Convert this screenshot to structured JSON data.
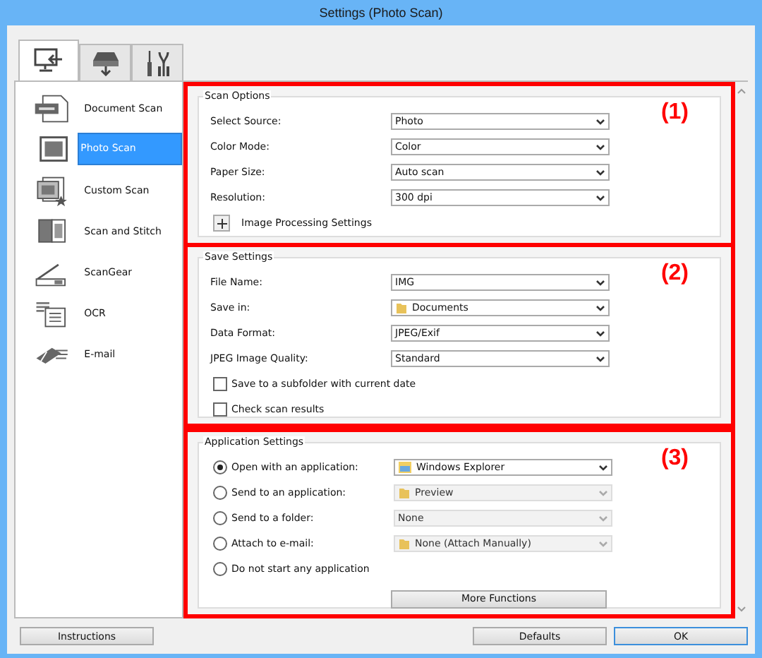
{
  "window": {
    "title": "Settings (Photo Scan)"
  },
  "tabs": [
    {
      "kind": "computer",
      "selected": true
    },
    {
      "kind": "scanner",
      "selected": false
    },
    {
      "kind": "tools",
      "selected": false
    }
  ],
  "sidebar": {
    "items": [
      {
        "label": "Document Scan",
        "kind": "pdf",
        "selected": false
      },
      {
        "label": "Photo Scan",
        "kind": "photo",
        "selected": true
      },
      {
        "label": "Custom Scan",
        "kind": "custom",
        "selected": false
      },
      {
        "label": "Scan and Stitch",
        "kind": "stitch",
        "selected": false
      },
      {
        "label": "ScanGear",
        "kind": "scangear",
        "selected": false
      },
      {
        "label": "OCR",
        "kind": "ocr",
        "selected": false
      },
      {
        "label": "E-mail",
        "kind": "email",
        "selected": false
      }
    ]
  },
  "sections": [
    {
      "marker": "(1)",
      "title": "Scan Options",
      "rows": [
        {
          "kind": "select",
          "label": "Select Source:",
          "dropdown": {
            "kind": "plain",
            "value": "Photo",
            "disabled": false
          }
        },
        {
          "kind": "select",
          "label": "Color Mode:",
          "dropdown": {
            "kind": "plain",
            "value": "Color",
            "disabled": false
          }
        },
        {
          "kind": "select",
          "label": "Paper Size:",
          "dropdown": {
            "kind": "plain",
            "value": "Auto scan",
            "disabled": false
          }
        },
        {
          "kind": "select",
          "label": "Resolution:",
          "dropdown": {
            "kind": "plain",
            "value": "300 dpi",
            "disabled": false
          }
        },
        {
          "kind": "expander",
          "label": "Image Processing Settings",
          "expanded": false
        }
      ]
    },
    {
      "marker": "(2)",
      "title": "Save Settings",
      "rows": [
        {
          "kind": "select",
          "label": "File Name:",
          "dropdown": {
            "kind": "plain",
            "value": "IMG",
            "disabled": false
          }
        },
        {
          "kind": "select",
          "label": "Save in:",
          "dropdown": {
            "kind": "folder",
            "value": "Documents",
            "disabled": false
          }
        },
        {
          "kind": "select",
          "label": "Data Format:",
          "dropdown": {
            "kind": "plain",
            "value": "JPEG/Exif",
            "disabled": false
          }
        },
        {
          "kind": "select",
          "label": "JPEG Image Quality:",
          "dropdown": {
            "kind": "plain",
            "value": "Standard",
            "disabled": false
          }
        },
        {
          "kind": "checkbox",
          "label": "Save to a subfolder with current date",
          "checked": false
        },
        {
          "kind": "checkbox",
          "label": "Check scan results",
          "checked": false
        }
      ]
    },
    {
      "marker": "(3)",
      "title": "Application Settings",
      "rows": [
        {
          "kind": "radio",
          "label": "Open with an application:",
          "selected": true,
          "dropdown": {
            "kind": "explorer",
            "value": "Windows Explorer",
            "disabled": false
          }
        },
        {
          "kind": "radio",
          "label": "Send to an application:",
          "selected": false,
          "dropdown": {
            "kind": "folder",
            "value": "Preview",
            "disabled": true
          }
        },
        {
          "kind": "radio",
          "label": "Send to a folder:",
          "selected": false,
          "dropdown": {
            "kind": "plain",
            "value": "None",
            "disabled": true
          }
        },
        {
          "kind": "radio",
          "label": "Attach to e-mail:",
          "selected": false,
          "dropdown": {
            "kind": "folder",
            "value": "None (Attach Manually)",
            "disabled": true
          }
        },
        {
          "kind": "radio",
          "label": "Do not start any application",
          "selected": false
        },
        {
          "kind": "button",
          "label": "More Functions"
        }
      ]
    }
  ],
  "footer": {
    "left_buttons": [
      "Instructions"
    ],
    "right_buttons": [
      {
        "label": "Defaults",
        "default": false
      },
      {
        "label": "OK",
        "default": true
      }
    ]
  }
}
